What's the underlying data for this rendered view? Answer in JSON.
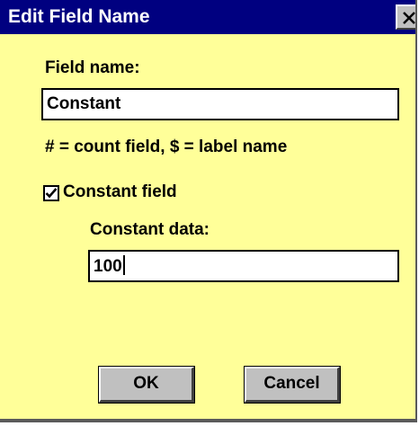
{
  "window": {
    "title": "Edit Field Name"
  },
  "form": {
    "field_name_label": "Field name:",
    "field_name_value": "Constant",
    "hint": "# = count field, $ = label name",
    "constant_field_label": "Constant field",
    "constant_field_checked": true,
    "constant_data_label": "Constant data:",
    "constant_data_value": "100"
  },
  "buttons": {
    "ok": "OK",
    "cancel": "Cancel"
  },
  "colors": {
    "background": "#ffff99",
    "titlebar": "#000080",
    "button_face": "#c0c0c0"
  },
  "icons": {
    "close": "close-icon",
    "check": "checkmark-icon"
  }
}
